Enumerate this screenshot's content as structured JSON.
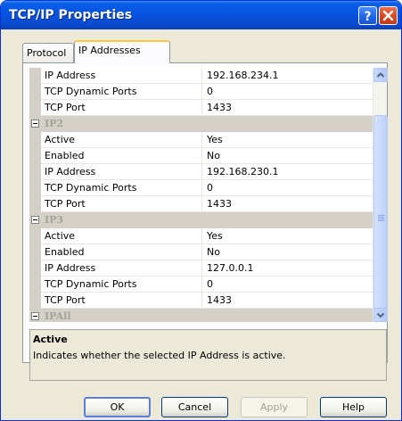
{
  "window": {
    "title": "TCP/IP Properties",
    "help_icon": "question-mark",
    "close_icon": "x-mark"
  },
  "tabs": [
    {
      "label": "Protocol",
      "active": false
    },
    {
      "label": "IP Addresses",
      "active": true
    }
  ],
  "grid": {
    "rows": [
      {
        "kind": "prop",
        "name": "IP Address",
        "value": "192.168.234.1"
      },
      {
        "kind": "prop",
        "name": "TCP Dynamic Ports",
        "value": "0"
      },
      {
        "kind": "prop",
        "name": "TCP Port",
        "value": "1433"
      },
      {
        "kind": "category",
        "name": "IP2"
      },
      {
        "kind": "prop",
        "name": "Active",
        "value": "Yes"
      },
      {
        "kind": "prop",
        "name": "Enabled",
        "value": "No"
      },
      {
        "kind": "prop",
        "name": "IP Address",
        "value": "192.168.230.1"
      },
      {
        "kind": "prop",
        "name": "TCP Dynamic Ports",
        "value": "0"
      },
      {
        "kind": "prop",
        "name": "TCP Port",
        "value": "1433"
      },
      {
        "kind": "category",
        "name": "IP3"
      },
      {
        "kind": "prop",
        "name": "Active",
        "value": "Yes"
      },
      {
        "kind": "prop",
        "name": "Enabled",
        "value": "No"
      },
      {
        "kind": "prop",
        "name": "IP Address",
        "value": "127.0.0.1"
      },
      {
        "kind": "prop",
        "name": "TCP Dynamic Ports",
        "value": "0"
      },
      {
        "kind": "prop",
        "name": "TCP Port",
        "value": "1433"
      },
      {
        "kind": "category",
        "name": "IPAll"
      }
    ]
  },
  "description": {
    "title": "Active",
    "text": "Indicates whether the selected IP Address is active."
  },
  "buttons": {
    "ok": "OK",
    "cancel": "Cancel",
    "apply": "Apply",
    "help": "Help"
  },
  "colors": {
    "titlebar": "#0553e0",
    "category_bg": "#d4d0c8",
    "category_text": "#a5a29b",
    "dialog_bg": "#ece9d8"
  }
}
